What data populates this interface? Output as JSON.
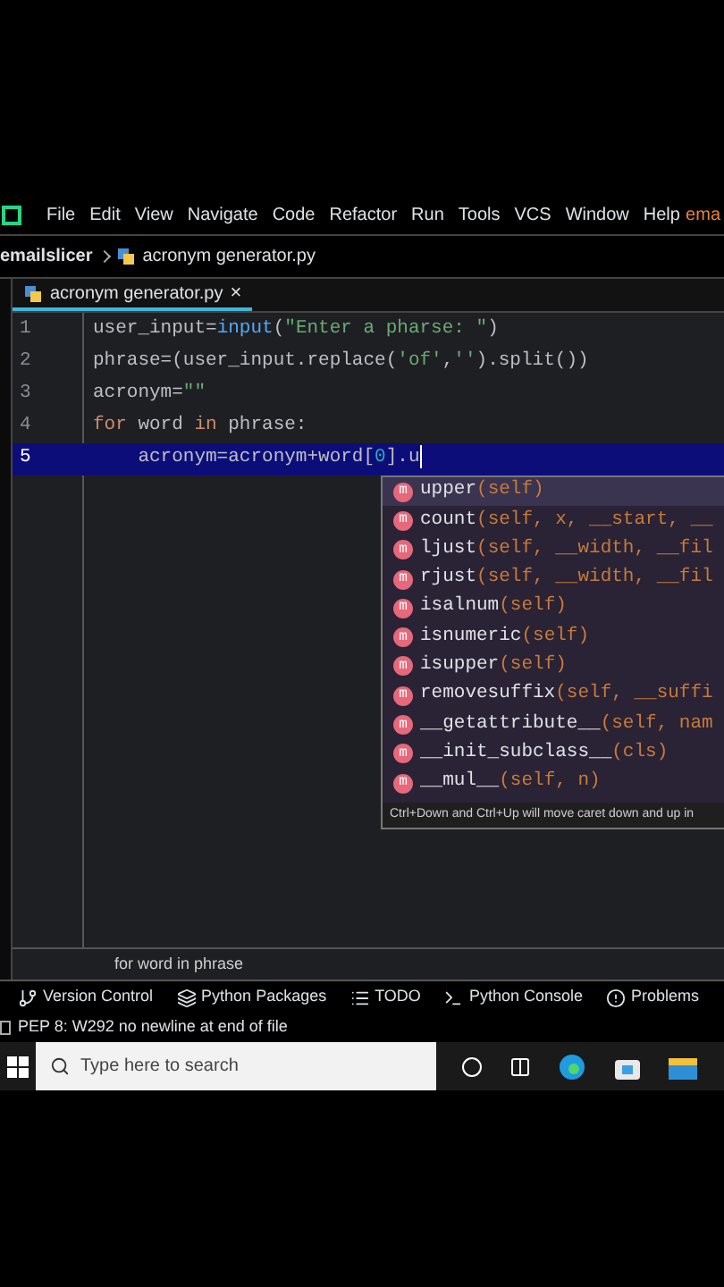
{
  "menu_bar": {
    "items": [
      "File",
      "Edit",
      "View",
      "Navigate",
      "Code",
      "Refactor",
      "Run",
      "Tools",
      "VCS",
      "Window",
      "Help"
    ],
    "project_label": "ema"
  },
  "breadcrumb": {
    "project": "emailslicer",
    "file": "acronym generator.py"
  },
  "editor_tabs": [
    {
      "label": "acronym generator.py",
      "selected": true,
      "close": "×"
    }
  ],
  "code_lines": [
    {
      "number": "1",
      "selected": false,
      "tokens": [
        {
          "text": "user_input=",
          "kind": "plain"
        },
        {
          "text": "input",
          "kind": "builtin"
        },
        {
          "text": "(",
          "kind": "plain"
        },
        {
          "text": "\"Enter a pharse: \"",
          "kind": "string"
        },
        {
          "text": ")",
          "kind": "plain"
        }
      ]
    },
    {
      "number": "2",
      "selected": false,
      "tokens": [
        {
          "text": "phrase=(user_input.replace(",
          "kind": "plain"
        },
        {
          "text": "'of'",
          "kind": "string"
        },
        {
          "text": ",",
          "kind": "plain"
        },
        {
          "text": "''",
          "kind": "string"
        },
        {
          "text": ").split())",
          "kind": "plain"
        }
      ]
    },
    {
      "number": "3",
      "selected": false,
      "tokens": [
        {
          "text": "acronym=",
          "kind": "plain"
        },
        {
          "text": "\"\"",
          "kind": "string"
        }
      ]
    },
    {
      "number": "4",
      "selected": false,
      "tokens": [
        {
          "text": "for",
          "kind": "keyword"
        },
        {
          "text": " word ",
          "kind": "plain"
        },
        {
          "text": "in",
          "kind": "keyword"
        },
        {
          "text": " phrase:",
          "kind": "plain"
        }
      ]
    },
    {
      "number": "5",
      "selected": true,
      "tokens": [
        {
          "text": "    acronym=acronym+word[",
          "kind": "plain"
        },
        {
          "text": "0",
          "kind": "number"
        },
        {
          "text": "].u",
          "kind": "plain"
        }
      ]
    }
  ],
  "completion": {
    "items": [
      {
        "icon": "m",
        "name": "upper",
        "signature": "(self)",
        "selected": true
      },
      {
        "icon": "m",
        "name": "count",
        "signature": "(self, x, __start, __",
        "selected": false
      },
      {
        "icon": "m",
        "name": "ljust",
        "signature": "(self, __width, __fil",
        "selected": false
      },
      {
        "icon": "m",
        "name": "rjust",
        "signature": "(self, __width, __fil",
        "selected": false
      },
      {
        "icon": "m",
        "name": "isalnum",
        "signature": "(self)",
        "selected": false
      },
      {
        "icon": "m",
        "name": "isnumeric",
        "signature": "(self)",
        "selected": false
      },
      {
        "icon": "m",
        "name": "isupper",
        "signature": "(self)",
        "selected": false
      },
      {
        "icon": "m",
        "name": "removesuffix",
        "signature": "(self, __suffi",
        "selected": false
      },
      {
        "icon": "m",
        "name": "__getattribute__",
        "signature": "(self, nam",
        "selected": false
      },
      {
        "icon": "m",
        "name": "__init_subclass__",
        "signature": "(cls)",
        "selected": false
      },
      {
        "icon": "m",
        "name": "__mul__",
        "signature": "(self, n)",
        "selected": false
      }
    ],
    "hint": "Ctrl+Down and Ctrl+Up will move caret down and up in"
  },
  "footer_breadcrumb": "for word in phrase",
  "tool_windows": [
    {
      "label": "Version Control",
      "kind": "vcs"
    },
    {
      "label": "Python Packages",
      "kind": "packages"
    },
    {
      "label": "TODO",
      "kind": "todo"
    },
    {
      "label": "Python Console",
      "kind": "console"
    },
    {
      "label": "Problems",
      "kind": "problems"
    }
  ],
  "status": "PEP 8: W292 no newline at end of file",
  "taskbar": {
    "search_placeholder": "Type here to search"
  }
}
